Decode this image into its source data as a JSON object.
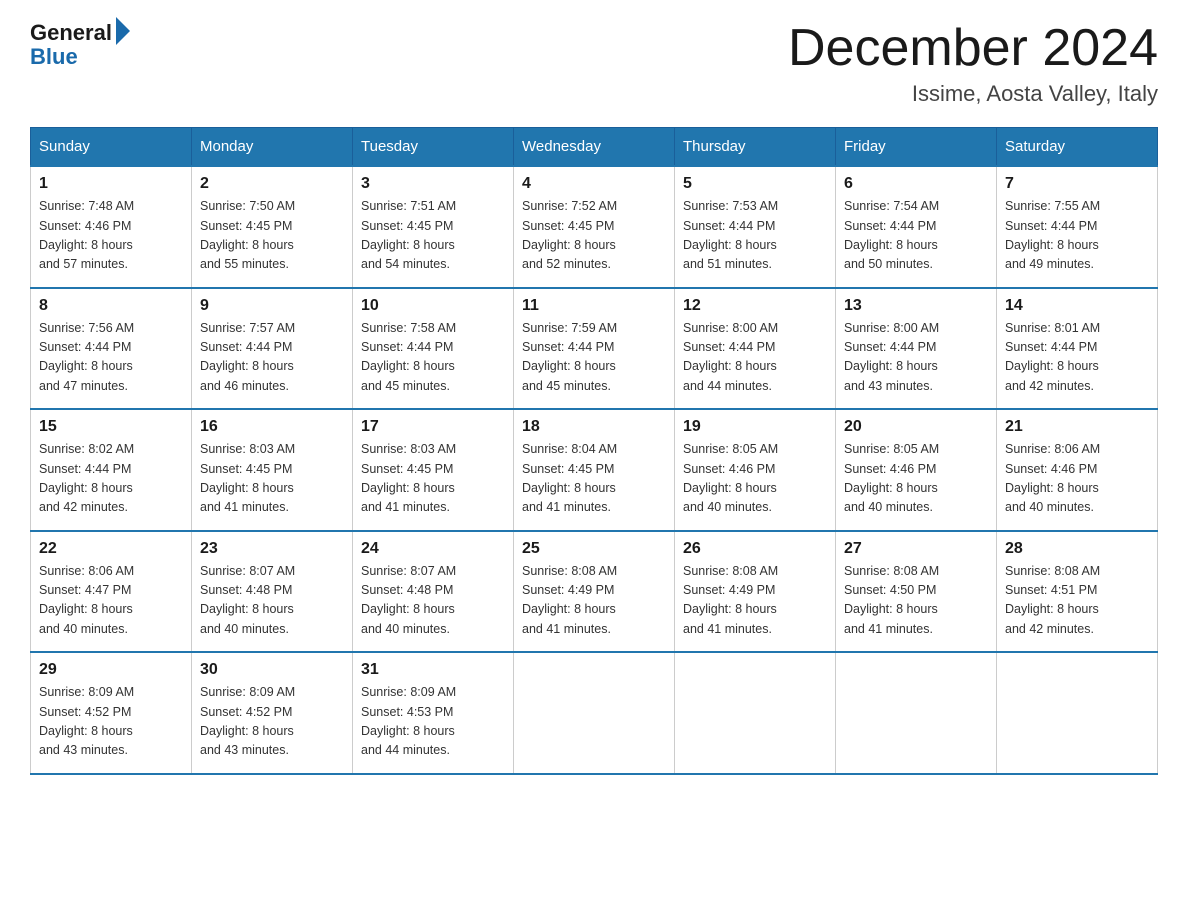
{
  "header": {
    "logo_general": "General",
    "logo_blue": "Blue",
    "month": "December 2024",
    "location": "Issime, Aosta Valley, Italy"
  },
  "weekdays": [
    "Sunday",
    "Monday",
    "Tuesday",
    "Wednesday",
    "Thursday",
    "Friday",
    "Saturday"
  ],
  "weeks": [
    [
      {
        "day": "1",
        "sunrise": "7:48 AM",
        "sunset": "4:46 PM",
        "daylight": "8 hours and 57 minutes."
      },
      {
        "day": "2",
        "sunrise": "7:50 AM",
        "sunset": "4:45 PM",
        "daylight": "8 hours and 55 minutes."
      },
      {
        "day": "3",
        "sunrise": "7:51 AM",
        "sunset": "4:45 PM",
        "daylight": "8 hours and 54 minutes."
      },
      {
        "day": "4",
        "sunrise": "7:52 AM",
        "sunset": "4:45 PM",
        "daylight": "8 hours and 52 minutes."
      },
      {
        "day": "5",
        "sunrise": "7:53 AM",
        "sunset": "4:44 PM",
        "daylight": "8 hours and 51 minutes."
      },
      {
        "day": "6",
        "sunrise": "7:54 AM",
        "sunset": "4:44 PM",
        "daylight": "8 hours and 50 minutes."
      },
      {
        "day": "7",
        "sunrise": "7:55 AM",
        "sunset": "4:44 PM",
        "daylight": "8 hours and 49 minutes."
      }
    ],
    [
      {
        "day": "8",
        "sunrise": "7:56 AM",
        "sunset": "4:44 PM",
        "daylight": "8 hours and 47 minutes."
      },
      {
        "day": "9",
        "sunrise": "7:57 AM",
        "sunset": "4:44 PM",
        "daylight": "8 hours and 46 minutes."
      },
      {
        "day": "10",
        "sunrise": "7:58 AM",
        "sunset": "4:44 PM",
        "daylight": "8 hours and 45 minutes."
      },
      {
        "day": "11",
        "sunrise": "7:59 AM",
        "sunset": "4:44 PM",
        "daylight": "8 hours and 45 minutes."
      },
      {
        "day": "12",
        "sunrise": "8:00 AM",
        "sunset": "4:44 PM",
        "daylight": "8 hours and 44 minutes."
      },
      {
        "day": "13",
        "sunrise": "8:00 AM",
        "sunset": "4:44 PM",
        "daylight": "8 hours and 43 minutes."
      },
      {
        "day": "14",
        "sunrise": "8:01 AM",
        "sunset": "4:44 PM",
        "daylight": "8 hours and 42 minutes."
      }
    ],
    [
      {
        "day": "15",
        "sunrise": "8:02 AM",
        "sunset": "4:44 PM",
        "daylight": "8 hours and 42 minutes."
      },
      {
        "day": "16",
        "sunrise": "8:03 AM",
        "sunset": "4:45 PM",
        "daylight": "8 hours and 41 minutes."
      },
      {
        "day": "17",
        "sunrise": "8:03 AM",
        "sunset": "4:45 PM",
        "daylight": "8 hours and 41 minutes."
      },
      {
        "day": "18",
        "sunrise": "8:04 AM",
        "sunset": "4:45 PM",
        "daylight": "8 hours and 41 minutes."
      },
      {
        "day": "19",
        "sunrise": "8:05 AM",
        "sunset": "4:46 PM",
        "daylight": "8 hours and 40 minutes."
      },
      {
        "day": "20",
        "sunrise": "8:05 AM",
        "sunset": "4:46 PM",
        "daylight": "8 hours and 40 minutes."
      },
      {
        "day": "21",
        "sunrise": "8:06 AM",
        "sunset": "4:46 PM",
        "daylight": "8 hours and 40 minutes."
      }
    ],
    [
      {
        "day": "22",
        "sunrise": "8:06 AM",
        "sunset": "4:47 PM",
        "daylight": "8 hours and 40 minutes."
      },
      {
        "day": "23",
        "sunrise": "8:07 AM",
        "sunset": "4:48 PM",
        "daylight": "8 hours and 40 minutes."
      },
      {
        "day": "24",
        "sunrise": "8:07 AM",
        "sunset": "4:48 PM",
        "daylight": "8 hours and 40 minutes."
      },
      {
        "day": "25",
        "sunrise": "8:08 AM",
        "sunset": "4:49 PM",
        "daylight": "8 hours and 41 minutes."
      },
      {
        "day": "26",
        "sunrise": "8:08 AM",
        "sunset": "4:49 PM",
        "daylight": "8 hours and 41 minutes."
      },
      {
        "day": "27",
        "sunrise": "8:08 AM",
        "sunset": "4:50 PM",
        "daylight": "8 hours and 41 minutes."
      },
      {
        "day": "28",
        "sunrise": "8:08 AM",
        "sunset": "4:51 PM",
        "daylight": "8 hours and 42 minutes."
      }
    ],
    [
      {
        "day": "29",
        "sunrise": "8:09 AM",
        "sunset": "4:52 PM",
        "daylight": "8 hours and 43 minutes."
      },
      {
        "day": "30",
        "sunrise": "8:09 AM",
        "sunset": "4:52 PM",
        "daylight": "8 hours and 43 minutes."
      },
      {
        "day": "31",
        "sunrise": "8:09 AM",
        "sunset": "4:53 PM",
        "daylight": "8 hours and 44 minutes."
      },
      null,
      null,
      null,
      null
    ]
  ],
  "labels": {
    "sunrise": "Sunrise:",
    "sunset": "Sunset:",
    "daylight": "Daylight:"
  }
}
